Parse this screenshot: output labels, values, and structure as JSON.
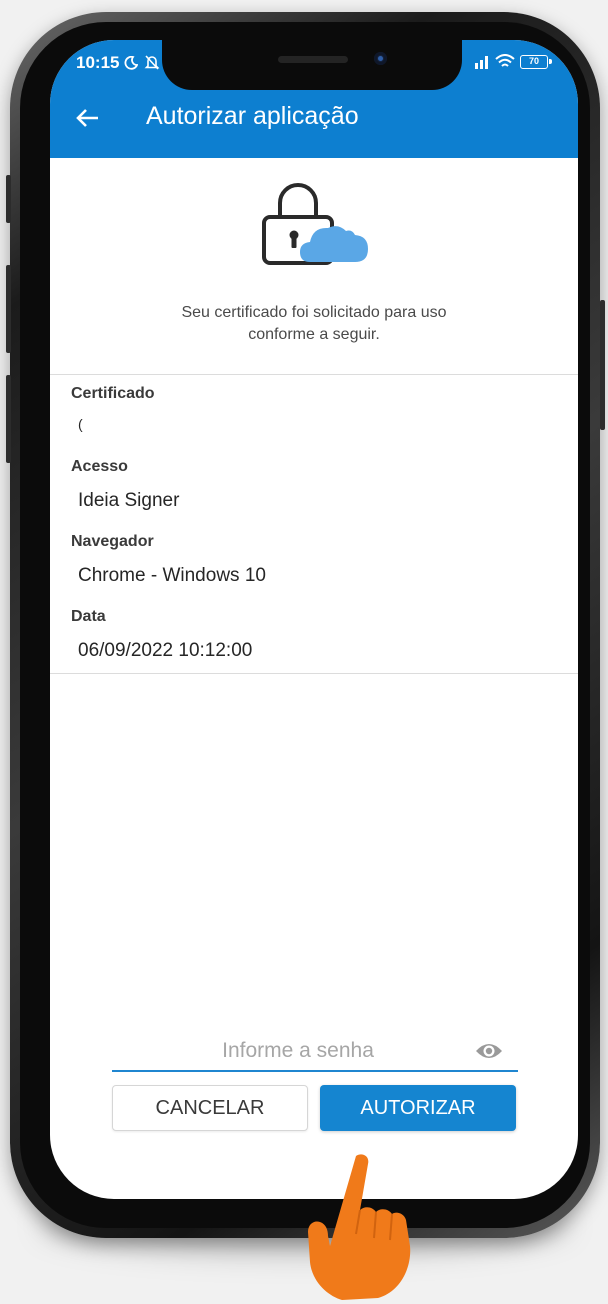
{
  "status_bar": {
    "time": "10:15",
    "battery": "70"
  },
  "appbar": {
    "title": "Autorizar aplicação"
  },
  "intro": {
    "line1": "Seu certificado foi solicitado para uso",
    "line2": "conforme a seguir."
  },
  "fields": {
    "certificado_label": "Certificado",
    "certificado_value": "(",
    "acesso_label": "Acesso",
    "acesso_value": "Ideia Signer",
    "navegador_label": "Navegador",
    "navegador_value": "Chrome - Windows 10",
    "data_label": "Data",
    "data_value": "06/09/2022 10:12:00"
  },
  "password": {
    "placeholder": "Informe a senha",
    "value": ""
  },
  "buttons": {
    "cancel": "CANCELAR",
    "authorize": "AUTORIZAR"
  },
  "colors": {
    "primary": "#0d7fd0",
    "button_primary": "#1585d0",
    "cloud": "#5aa7e6",
    "hand": "#f07a1a"
  },
  "icons": {
    "back": "arrow-left-icon",
    "lock": "lock-cloud-icon",
    "password_toggle": "eye-icon",
    "pointer": "pointing-hand-icon"
  }
}
